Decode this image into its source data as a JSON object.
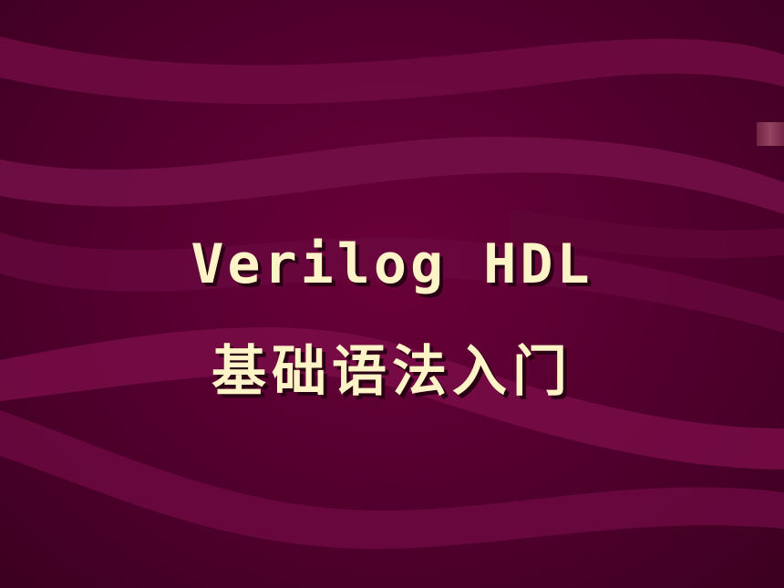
{
  "slide": {
    "title_line1": "Verilog HDL",
    "title_line2": "基础语法入门"
  },
  "colors": {
    "background": "#560030",
    "wave": "#7a0a45",
    "title_text": "#fff4c8",
    "title_shadow": "#2a0014"
  }
}
